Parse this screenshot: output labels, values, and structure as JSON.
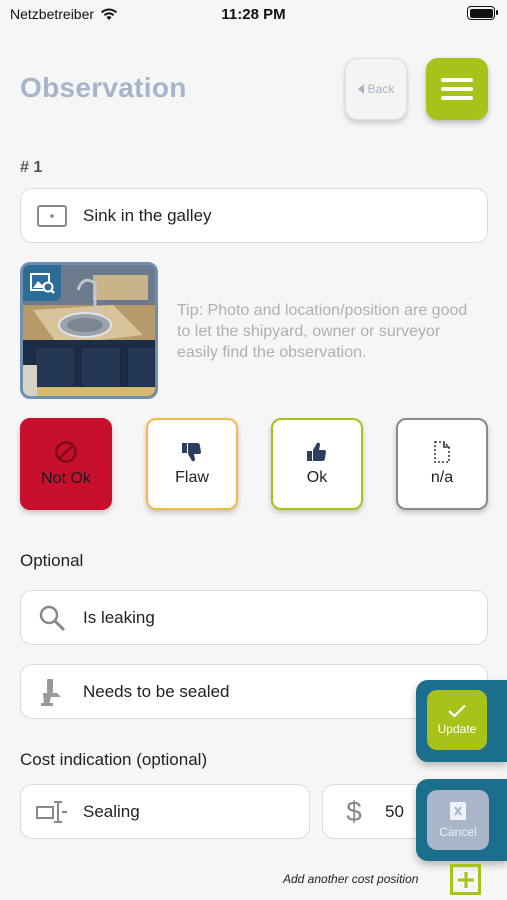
{
  "status_bar": {
    "carrier": "Netzbetreiber",
    "time": "11:28 PM"
  },
  "header": {
    "title": "Observation",
    "back_label": "Back"
  },
  "observation": {
    "number": "# 1",
    "title": "Sink in the galley",
    "tip": "Tip: Photo and location/position are good to let the shipyard, owner or surveyor easily find the observation."
  },
  "ratings": [
    {
      "label": "Not Ok",
      "color": "#c8102e"
    },
    {
      "label": "Flaw",
      "color": "#f2b94a"
    },
    {
      "label": "Ok",
      "color": "#a8c21a"
    },
    {
      "label": "n/a",
      "color": "#8a8a8a"
    }
  ],
  "optional": {
    "label": "Optional",
    "problem": "Is leaking",
    "action": "Needs to be sealed"
  },
  "cost": {
    "label": "Cost indication (optional)",
    "description": "Sealing",
    "amount": "50",
    "add_label": "Add another cost position"
  },
  "actions": {
    "update_label": "Update",
    "cancel_label": "Cancel"
  },
  "colors": {
    "accent": "#a8c21a",
    "panel": "#1b6f8c",
    "title": "#a6b4cc"
  }
}
